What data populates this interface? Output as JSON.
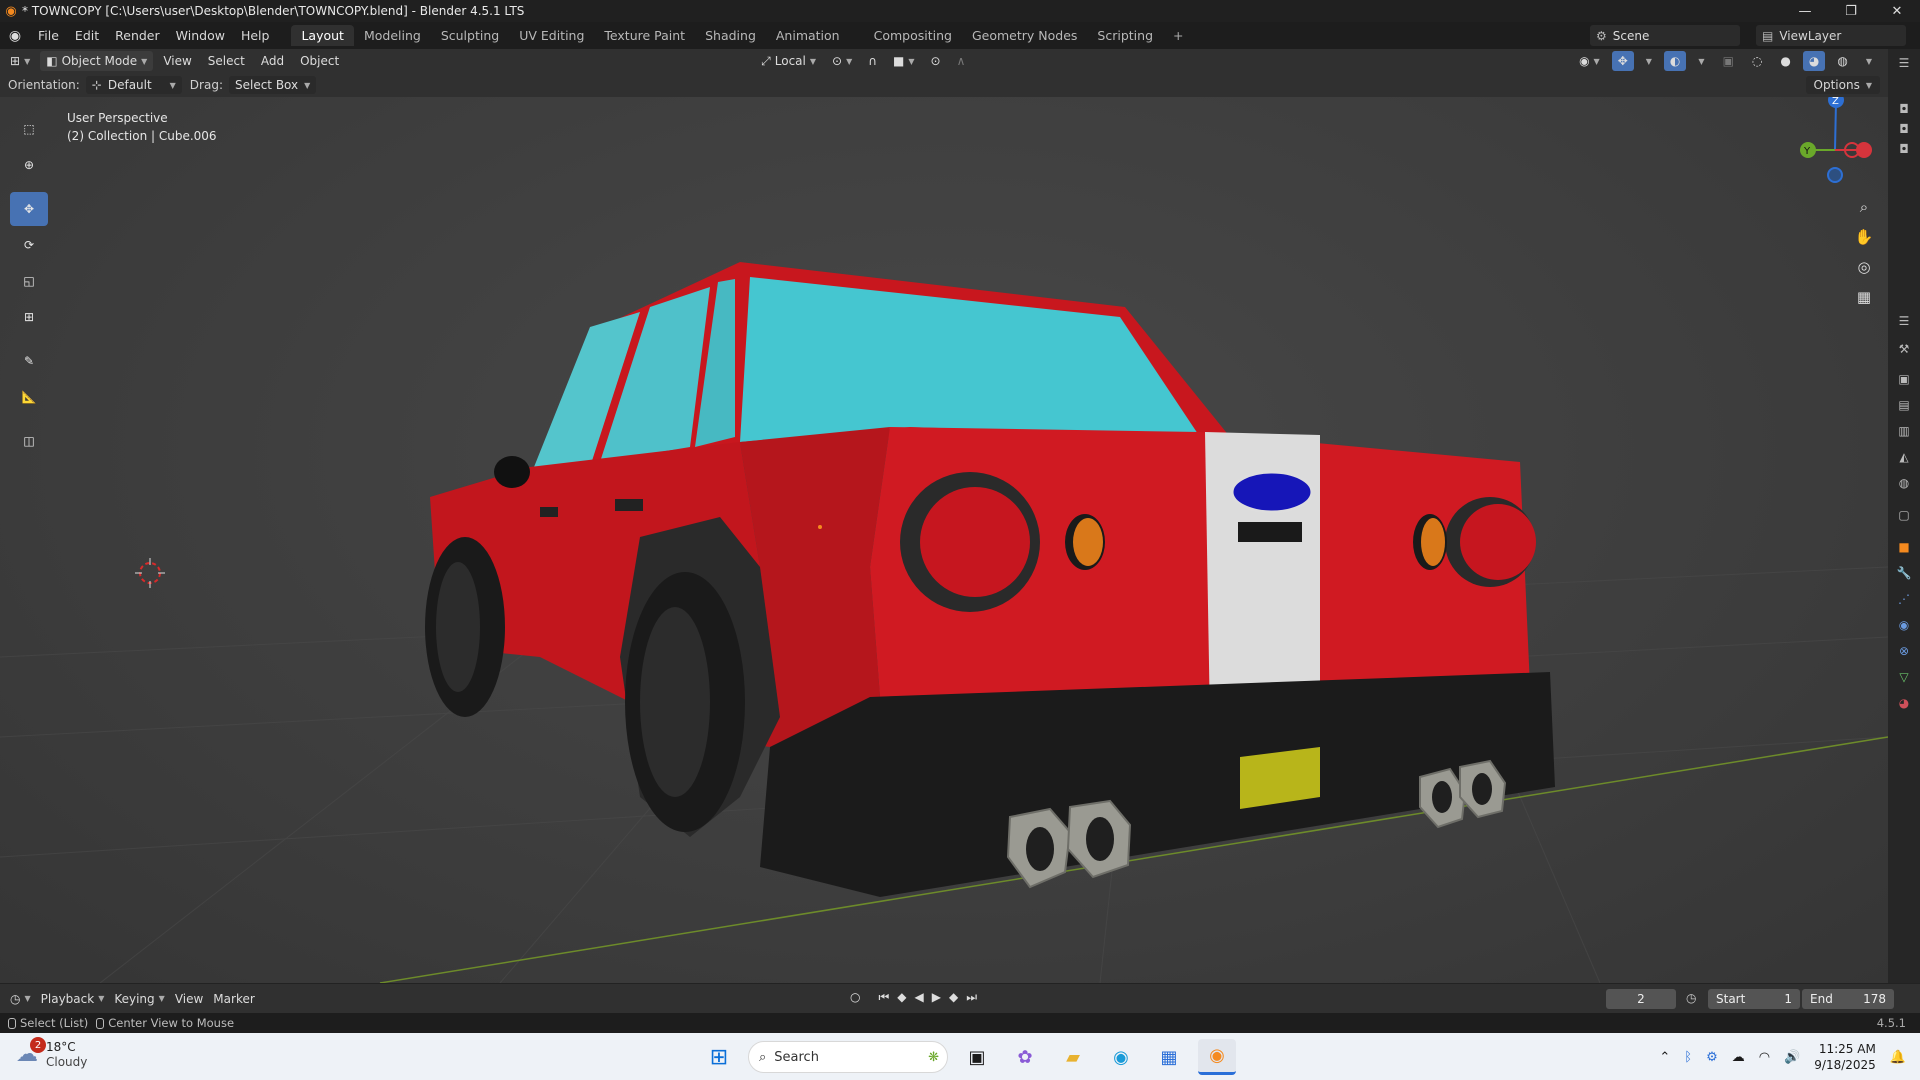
{
  "window": {
    "title": "* TOWNCOPY [C:\\Users\\user\\Desktop\\Blender\\TOWNCOPY.blend] - Blender 4.5.1 LTS",
    "controls": [
      "—",
      "❐",
      "✕"
    ]
  },
  "menu": {
    "items": [
      "File",
      "Edit",
      "Render",
      "Window",
      "Help"
    ]
  },
  "workspaces": {
    "tabs": [
      "Layout",
      "Modeling",
      "Sculpting",
      "UV Editing",
      "Texture Paint",
      "Shading",
      "Animation",
      "Compositing",
      "Geometry Nodes",
      "Scripting"
    ],
    "active": "Layout",
    "add": "+"
  },
  "scene": {
    "label": "Scene",
    "view_layer": "ViewLayer"
  },
  "viewport_header": {
    "mode": "Object Mode",
    "menus": [
      "View",
      "Select",
      "Add",
      "Object"
    ],
    "transform_space": "Local"
  },
  "tool_settings": {
    "orientation_label": "Orientation:",
    "orientation_value": "Default",
    "drag_label": "Drag:",
    "drag_value": "Select Box",
    "options": "Options"
  },
  "viewport": {
    "perspective": "User Perspective",
    "collection_info": "(2) Collection | Cube.006"
  },
  "gizmo": {
    "z": "Z",
    "y": "Y",
    "x": "X"
  },
  "tools": [
    "select-box",
    "cursor",
    "move",
    "rotate",
    "scale",
    "transform",
    "annotate",
    "measure",
    "add-cube"
  ],
  "timeline": {
    "menus": [
      "Playback",
      "Keying",
      "View",
      "Marker"
    ],
    "current_frame": "2",
    "start_label": "Start",
    "start_value": "1",
    "end_label": "End",
    "end_value": "178"
  },
  "statusbar": {
    "hint1": "Select (List)",
    "hint2": "Center View to Mouse",
    "version": "4.5.1"
  },
  "taskbar": {
    "weather_temp": "18°C",
    "weather_cond": "Cloudy",
    "notification_count": "2",
    "search_placeholder": "Search",
    "time": "11:25 AM",
    "date": "9/18/2025"
  },
  "colors": {
    "accent": "#4772b3",
    "car_body": "#c8171e",
    "window_glass": "#45c6d0"
  }
}
